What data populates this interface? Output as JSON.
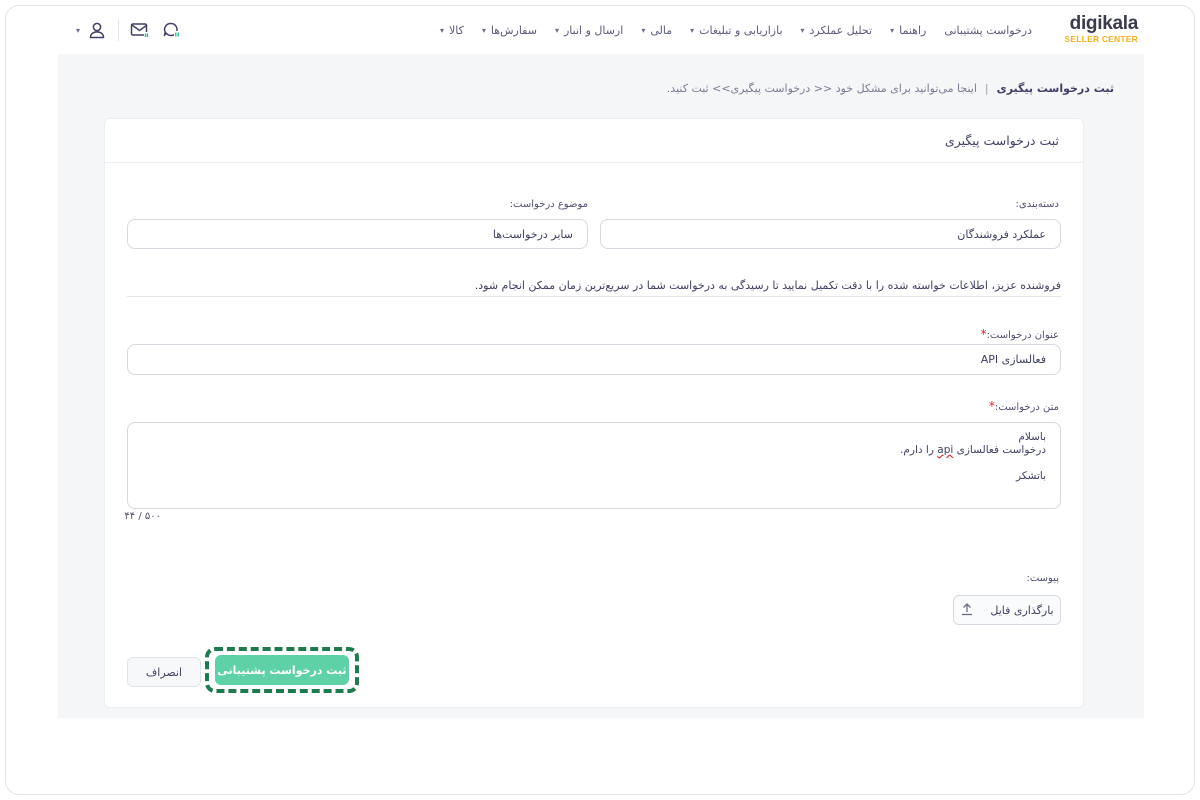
{
  "logo": {
    "main": "digikala",
    "sub": "SELLER CENTER"
  },
  "nav": {
    "items": [
      {
        "label": "کالا"
      },
      {
        "label": "سفارش‌ها"
      },
      {
        "label": "ارسال و انبار"
      },
      {
        "label": "مالی"
      },
      {
        "label": "بازاریابی و تبلیغات"
      },
      {
        "label": "تحلیل عملکرد"
      },
      {
        "label": "راهنما"
      },
      {
        "label": "درخواست پشتیبانی"
      }
    ]
  },
  "icons": {
    "chat": "chat-bubble-icon",
    "mail": "mail-icon",
    "user": "user-icon",
    "accent": "#2fbf86"
  },
  "breadcrumb": {
    "title": "ثبت درخواست پیگیری",
    "separator": "|",
    "description": "اینجا می‌توانید برای مشکل خود << درخواست پیگیری>> ثبت کنید."
  },
  "form": {
    "heading": "ثبت درخواست پیگیری",
    "category": {
      "label": "دسته‌بندی:",
      "value": "عملکرد فروشندگان"
    },
    "subject": {
      "label": "موضوع درخواست:",
      "value": "سایر درخواست‌ها"
    },
    "notice": "فروشنده عزیز، اطلاعات خواسته شده را با دقت تکمیل نمایید تا رسیدگی به درخواست شما در سریع‌ترین زمان ممکن انجام شود.",
    "title_field": {
      "label": "عنوان درخواست:",
      "required_mark": "*",
      "value": "فعالسازی API"
    },
    "body_field": {
      "label": "متن درخواست:",
      "required_mark": "*",
      "line1": "باسلام",
      "line2_pre": "درخواست فعالسازی ",
      "line2_api": "api",
      "line2_post": " را دارم.",
      "line3": "باتشکر",
      "counter": "۴۴ / ۵۰۰"
    },
    "attachment": {
      "label": "پیوست:",
      "button": "بارگذاری فایل"
    },
    "submit": "ثبت درخواست پشتیبانی",
    "cancel": "انصراف"
  },
  "colors": {
    "submit": "#5fd1a6",
    "highlight_border": "#1f7a4d",
    "required": "#e0202a",
    "logo_sub": "#f2b01e"
  }
}
